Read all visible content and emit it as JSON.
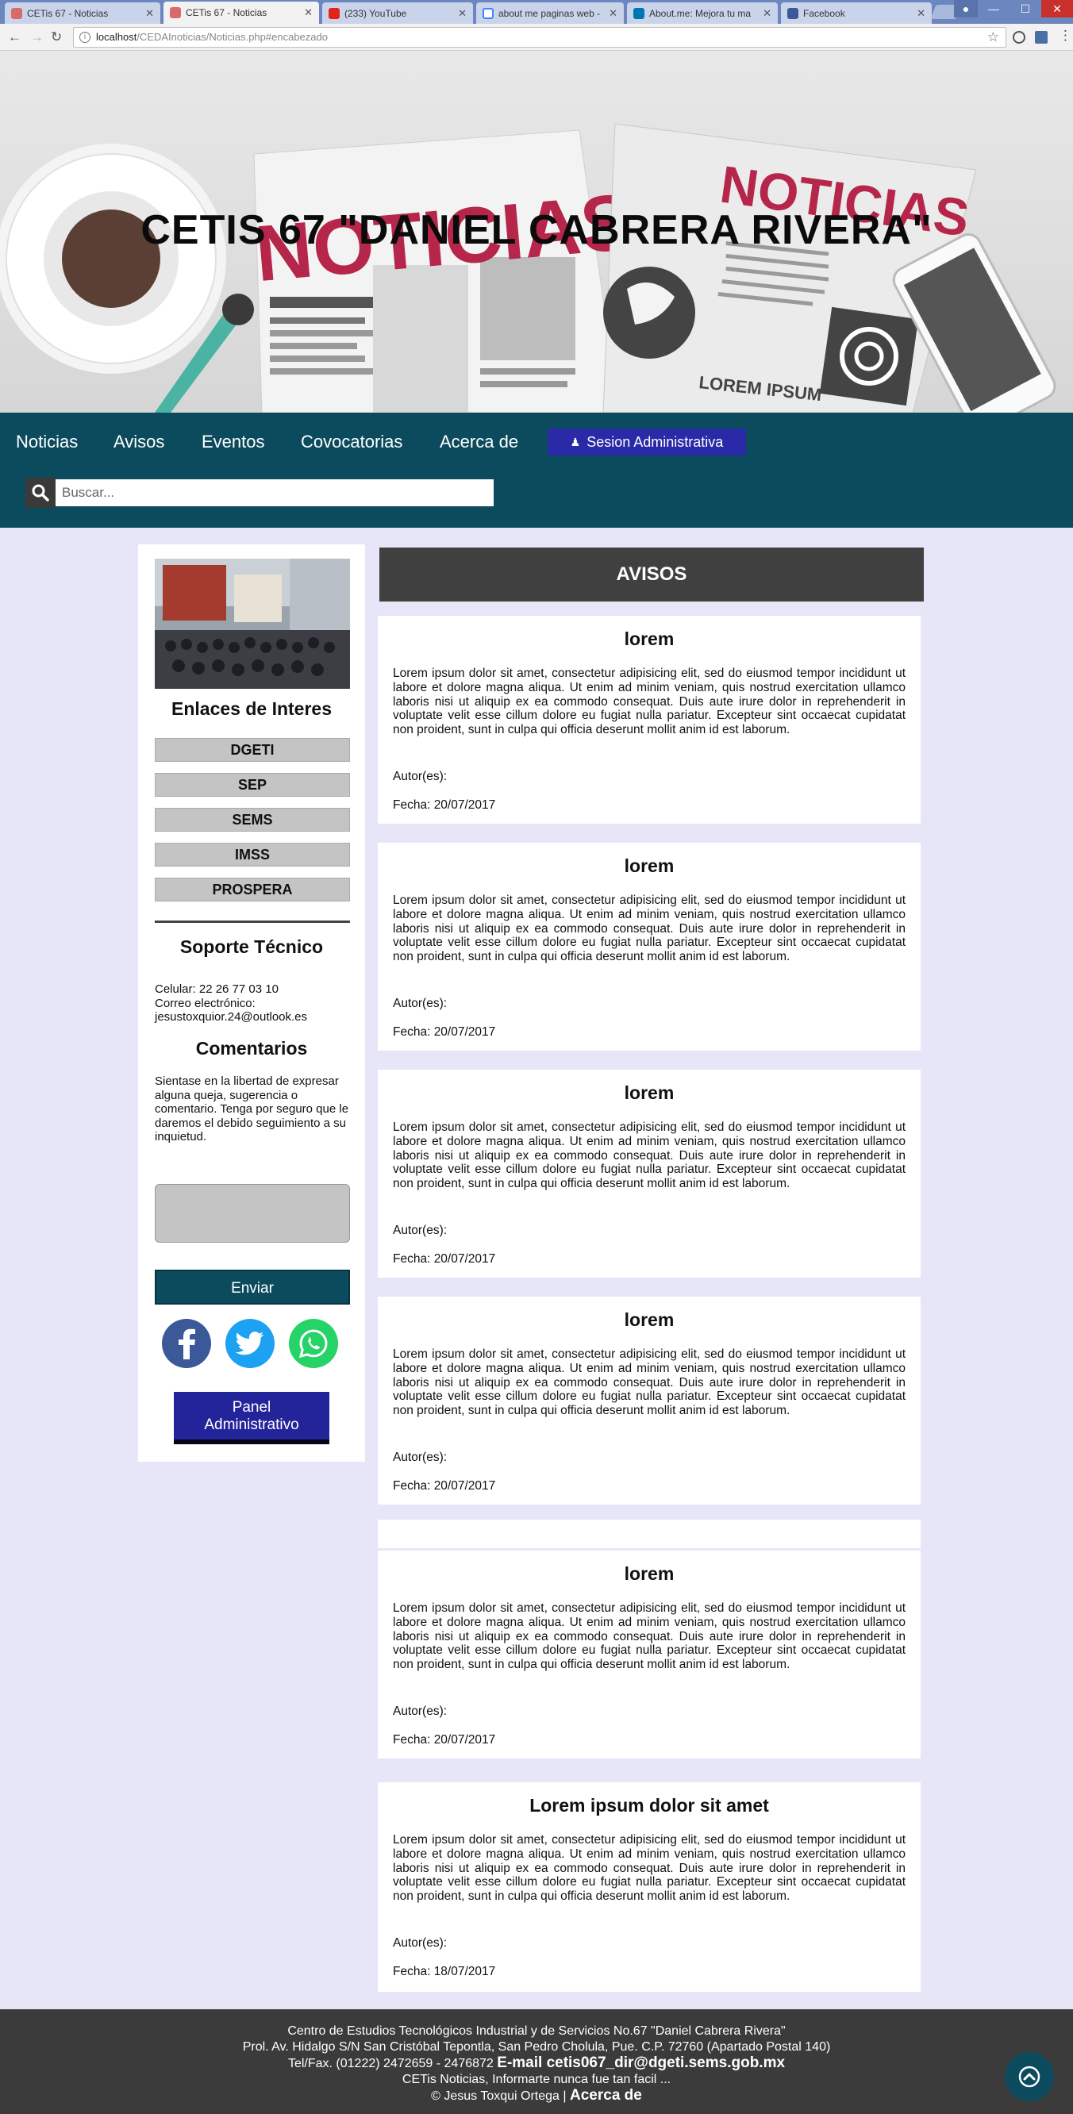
{
  "browser": {
    "tabs": [
      {
        "label": "CETis 67 - Noticias",
        "active": false
      },
      {
        "label": "CETis 67 - Noticias",
        "active": true
      },
      {
        "label": "(233) YouTube",
        "active": false
      },
      {
        "label": "about me paginas web -",
        "active": false
      },
      {
        "label": "About.me: Mejora tu ma",
        "active": false
      },
      {
        "label": "Facebook",
        "active": false
      }
    ],
    "url_host": "localhost",
    "url_path": "/CEDAInoticias/Noticias.php#encabezado"
  },
  "header": {
    "title": "CETIS 67 \"DANIEL CABRERA RIVERA\"",
    "newspaper_word": "NOTICIAS",
    "lorem_label": "LOREM IPSUM"
  },
  "nav": {
    "items": [
      "Noticias",
      "Avisos",
      "Eventos",
      "Covocatorias",
      "Acerca de"
    ],
    "admin_label": "Sesion Administrativa",
    "search_placeholder": "Buscar..."
  },
  "sidebar": {
    "links_title": "Enlaces de Interes",
    "links": [
      "DGETI",
      "SEP",
      "SEMS",
      "IMSS",
      "PROSPERA"
    ],
    "support_title": "Soporte Técnico",
    "phone": "Celular: 22 26 77 03 10",
    "email_label": "Correo electrónico:",
    "email": "jesustoxquior.24@outlook.es",
    "comments_title": "Comentarios",
    "comments_text": "Sientase en la libertad de expresar alguna queja, sugerencia o comentario. Tenga por seguro que le daremos el debido seguimiento a su inquietud.",
    "send_label": "Enviar",
    "panel_label_1": "Panel",
    "panel_label_2": "Administrativo"
  },
  "main": {
    "section_title": "AVISOS",
    "posts": [
      {
        "title": "lorem",
        "body": "Lorem ipsum dolor sit amet, consectetur adipisicing elit, sed do eiusmod tempor incididunt ut labore et dolore magna aliqua. Ut enim ad minim veniam, quis nostrud exercitation ullamco laboris nisi ut aliquip ex ea commodo consequat. Duis aute irure dolor in reprehenderit in voluptate velit esse cillum dolore eu fugiat nulla pariatur. Excepteur sint occaecat cupidatat non proident, sunt in culpa qui officia deserunt mollit anim id est laborum.",
        "author": "Autor(es):",
        "date": "Fecha: 20/07/2017"
      },
      {
        "title": "lorem",
        "body": "Lorem ipsum dolor sit amet, consectetur adipisicing elit, sed do eiusmod tempor incididunt ut labore et dolore magna aliqua. Ut enim ad minim veniam, quis nostrud exercitation ullamco laboris nisi ut aliquip ex ea commodo consequat. Duis aute irure dolor in reprehenderit in voluptate velit esse cillum dolore eu fugiat nulla pariatur. Excepteur sint occaecat cupidatat non proident, sunt in culpa qui officia deserunt mollit anim id est laborum.",
        "author": "Autor(es):",
        "date": "Fecha: 20/07/2017"
      },
      {
        "title": "lorem",
        "body": "Lorem ipsum dolor sit amet, consectetur adipisicing elit, sed do eiusmod tempor incididunt ut labore et dolore magna aliqua. Ut enim ad minim veniam, quis nostrud exercitation ullamco laboris nisi ut aliquip ex ea commodo consequat. Duis aute irure dolor in reprehenderit in voluptate velit esse cillum dolore eu fugiat nulla pariatur. Excepteur sint occaecat cupidatat non proident, sunt in culpa qui officia deserunt mollit anim id est laborum.",
        "author": "Autor(es):",
        "date": "Fecha: 20/07/2017"
      },
      {
        "title": "lorem",
        "body": "Lorem ipsum dolor sit amet, consectetur adipisicing elit, sed do eiusmod tempor incididunt ut labore et dolore magna aliqua. Ut enim ad minim veniam, quis nostrud exercitation ullamco laboris nisi ut aliquip ex ea commodo consequat. Duis aute irure dolor in reprehenderit in voluptate velit esse cillum dolore eu fugiat nulla pariatur. Excepteur sint occaecat cupidatat non proident, sunt in culpa qui officia deserunt mollit anim id est laborum.",
        "author": "Autor(es):",
        "date": "Fecha: 20/07/2017"
      },
      {
        "title": "lorem",
        "body": "Lorem ipsum dolor sit amet, consectetur adipisicing elit, sed do eiusmod tempor incididunt ut labore et dolore magna aliqua. Ut enim ad minim veniam, quis nostrud exercitation ullamco laboris nisi ut aliquip ex ea commodo consequat. Duis aute irure dolor in reprehenderit in voluptate velit esse cillum dolore eu fugiat nulla pariatur. Excepteur sint occaecat cupidatat non proident, sunt in culpa qui officia deserunt mollit anim id est laborum.",
        "author": "Autor(es):",
        "date": "Fecha: 20/07/2017"
      },
      {
        "title": "Lorem ipsum dolor sit amet",
        "body": "Lorem ipsum dolor sit amet, consectetur adipisicing elit, sed do eiusmod tempor incididunt ut labore et dolore magna aliqua. Ut enim ad minim veniam, quis nostrud exercitation ullamco laboris nisi ut aliquip ex ea commodo consequat. Duis aute irure dolor in reprehenderit in voluptate velit esse cillum dolore eu fugiat nulla pariatur. Excepteur sint occaecat cupidatat non proident, sunt in culpa qui officia deserunt mollit anim id est laborum.",
        "author": "Autor(es):",
        "date": "Fecha: 18/07/2017"
      }
    ]
  },
  "footer": {
    "line1": "Centro de Estudios Tecnológicos Industrial y de Servicios No.67 \"Daniel Cabrera Rivera\"",
    "line2": "Prol. Av. Hidalgo S/N San Cristóbal Tepontla, San Pedro Cholula, Pue. C.P. 72760 (Apartado Postal 140)",
    "phone": "Tel/Fax. (01222) 2472659 - 2476872",
    "email": "E-mail cetis067_dir@dgeti.sems.gob.mx",
    "tagline": "CETis Noticias, Informarte nunca fue tan facil ...",
    "credit": "© Jesus Toxqui Ortega |",
    "about": "Acerca de"
  },
  "colors": {
    "nav": "#0c4b5e",
    "admin": "#2a2aa8",
    "avisos": "#404040",
    "page_bg": "#e6e6f8",
    "footer": "#3b3b3b"
  }
}
